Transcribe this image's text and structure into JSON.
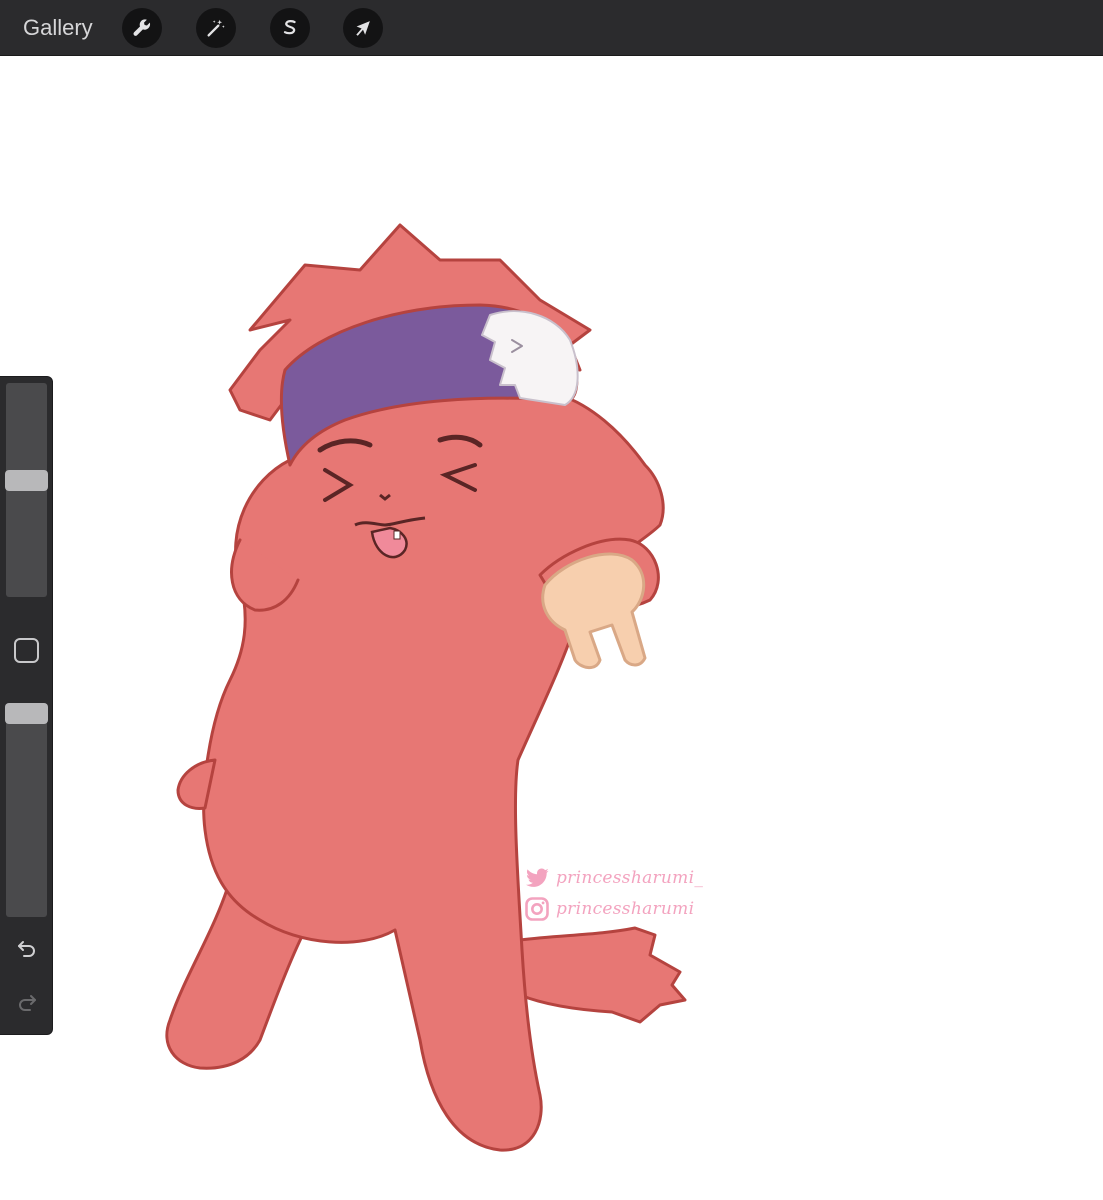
{
  "topbar": {
    "gallery_label": "Gallery",
    "tools": [
      {
        "name": "wrench-icon",
        "action": "Actions"
      },
      {
        "name": "magic-wand-icon",
        "action": "Adjustments"
      },
      {
        "name": "selection-s-icon",
        "action": "Selection"
      },
      {
        "name": "arrow-cursor-icon",
        "action": "Transform"
      }
    ]
  },
  "sidebar": {
    "brush_size_level": 0.55,
    "opacity_level": 1.0,
    "modify_icon": "square-modify-icon",
    "undo_icon": "undo-icon",
    "redo_icon": "redo-icon"
  },
  "watermark": {
    "twitter_handle": "princessharumi_",
    "instagram_handle": "princessharumi"
  },
  "colors": {
    "toolbar_bg": "#2b2b2d",
    "character_body": "#e77774",
    "character_outline": "#b5433f",
    "headband": "#7b5a9c",
    "hand": "#f7cfae",
    "watermark": "#f3a3bf"
  }
}
